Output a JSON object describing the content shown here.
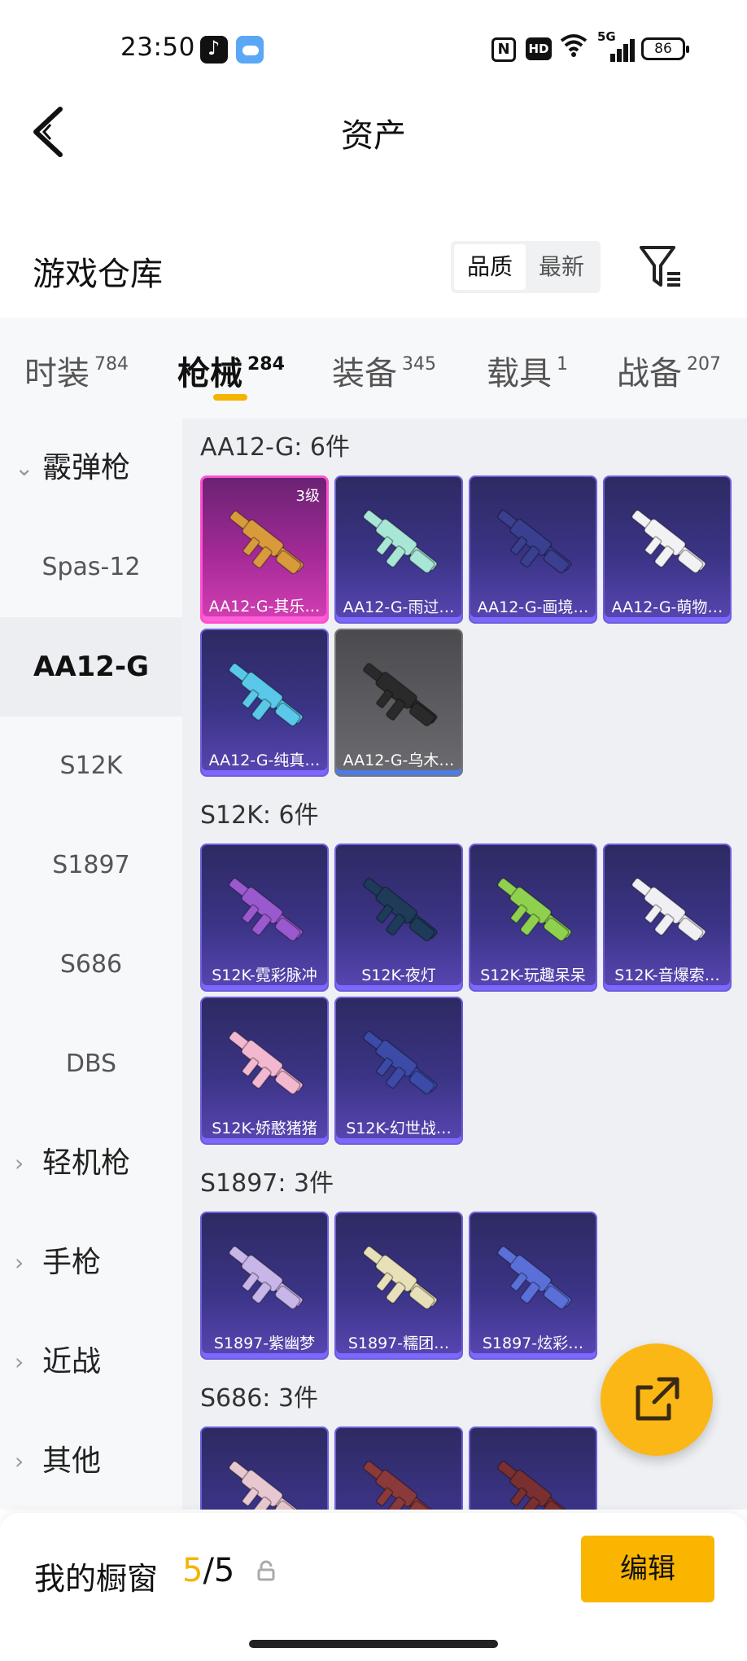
{
  "status_bar": {
    "time": "23:50",
    "nfc": "N",
    "hd": "HD",
    "network": "5G",
    "battery": "86"
  },
  "header": {
    "title": "资产",
    "back_icon": "chevron-left-icon"
  },
  "warehouse": {
    "title": "游戏仓库",
    "sort_options": [
      "品质",
      "最新"
    ],
    "active_sort": "品质",
    "filter_icon": "filter-icon"
  },
  "tabs": [
    {
      "label": "时装",
      "count": "784"
    },
    {
      "label": "枪械",
      "count": "284"
    },
    {
      "label": "装备",
      "count": "345"
    },
    {
      "label": "载具",
      "count": "1"
    },
    {
      "label": "战备",
      "count": "207"
    }
  ],
  "active_tab": "枪械",
  "sidebar": {
    "groups": [
      {
        "label": "霰弹枪",
        "expanded": true,
        "items": [
          "Spas-12",
          "AA12-G",
          "S12K",
          "S1897",
          "S686",
          "DBS"
        ],
        "active_item": "AA12-G"
      },
      {
        "label": "轻机枪",
        "expanded": false
      },
      {
        "label": "手枪",
        "expanded": false
      },
      {
        "label": "近战",
        "expanded": false
      },
      {
        "label": "其他",
        "expanded": false
      }
    ]
  },
  "sections": [
    {
      "title": "AA12-G: 6件",
      "items": [
        {
          "name": "AA12-G-其乐…",
          "level": "3级",
          "rarity": "pink",
          "gun_color": "#d99a3b"
        },
        {
          "name": "AA12-G-雨过…",
          "rarity": "purple",
          "gun_color": "#a8e6d6"
        },
        {
          "name": "AA12-G-画境…",
          "rarity": "purple",
          "gun_color": "#3a3f8f"
        },
        {
          "name": "AA12-G-萌物…",
          "rarity": "purple",
          "gun_color": "#f2f2f5"
        },
        {
          "name": "AA12-G-纯真…",
          "rarity": "purple",
          "gun_color": "#5ac8e8"
        },
        {
          "name": "AA12-G-乌木…",
          "rarity": "gray",
          "gun_color": "#2a2a2a"
        }
      ]
    },
    {
      "title": "S12K: 6件",
      "items": [
        {
          "name": "S12K-霓彩脉冲",
          "rarity": "purple",
          "gun_color": "#9b59d0"
        },
        {
          "name": "S12K-夜灯",
          "rarity": "purple",
          "gun_color": "#1f3b5a"
        },
        {
          "name": "S12K-玩趣呆呆",
          "rarity": "purple",
          "gun_color": "#8fd14f"
        },
        {
          "name": "S12K-音爆索…",
          "rarity": "purple",
          "gun_color": "#f0f0f4"
        },
        {
          "name": "S12K-娇憨猪猪",
          "rarity": "purple",
          "gun_color": "#f2b8cf"
        },
        {
          "name": "S12K-幻世战…",
          "rarity": "purple",
          "gun_color": "#3c4aa8"
        }
      ]
    },
    {
      "title": "S1897: 3件",
      "items": [
        {
          "name": "S1897-紫幽梦",
          "rarity": "purple",
          "gun_color": "#c8b6e8"
        },
        {
          "name": "S1897-糯团…",
          "rarity": "purple",
          "gun_color": "#e8e0b8"
        },
        {
          "name": "S1897-炫彩…",
          "rarity": "purple",
          "gun_color": "#5a6fd8"
        }
      ]
    },
    {
      "title": "S686: 3件",
      "items": [
        {
          "name": "",
          "rarity": "purple",
          "gun_color": "#e8c8d0"
        },
        {
          "name": "",
          "rarity": "purple",
          "gun_color": "#8a3a3a"
        },
        {
          "name": "",
          "rarity": "purple",
          "gun_color": "#7a3030"
        }
      ]
    }
  ],
  "fab": {
    "icon": "share-icon"
  },
  "showcase": {
    "label": "我的橱窗",
    "current": "5",
    "total": "/5",
    "lock_icon": "lock-icon",
    "edit_label": "编辑"
  }
}
